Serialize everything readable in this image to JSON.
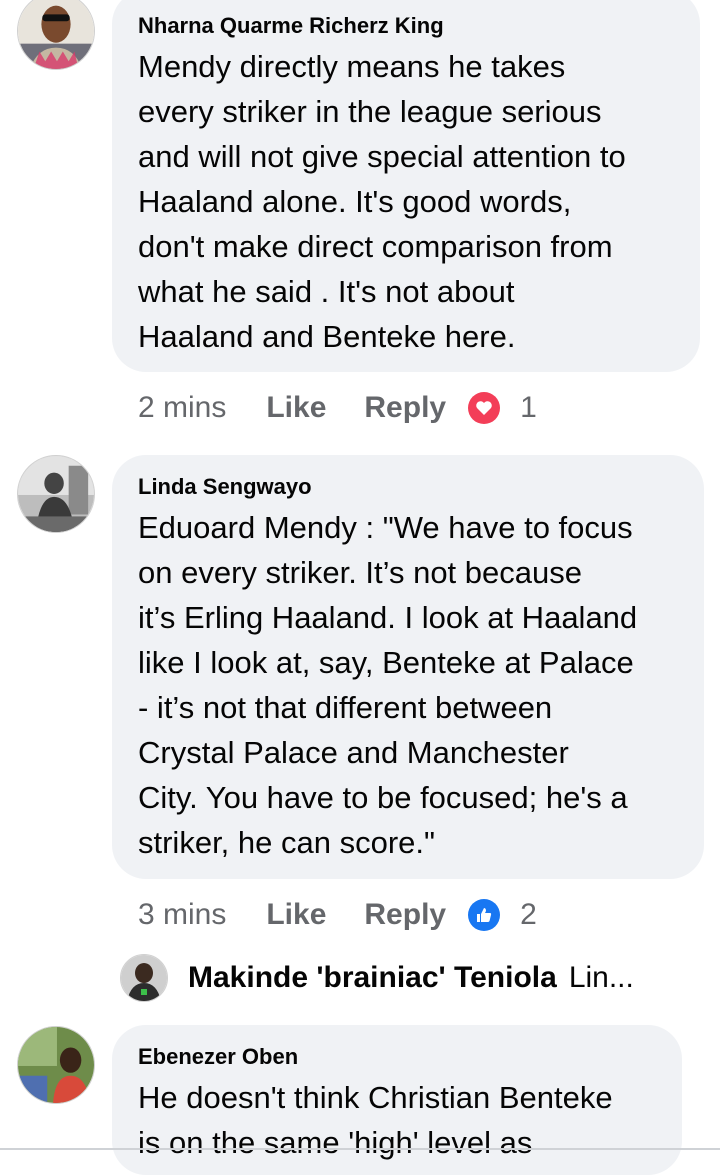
{
  "comments": [
    {
      "author": "Nharna Quarme Richerz King",
      "lines": [
        "Mendy directly means he takes",
        "every striker in the league serious",
        "and will not give special attention to",
        "Haaland alone. It's good words,",
        "don't make direct comparison from",
        "what he said . It's not about",
        "Haaland and Benteke here."
      ],
      "time": "2 mins",
      "like_label": "Like",
      "reply_label": "Reply",
      "reaction_icon": "heart-reaction-icon",
      "reaction_color": "#f33e58",
      "reaction_count": "1"
    },
    {
      "author": "Linda Sengwayo",
      "lines": [
        "Eduoard Mendy : \"We have to focus",
        "on every striker. It’s not because",
        "it’s Erling Haaland. I look at Haaland",
        "like I look at, say, Benteke at Palace",
        "- it’s not that different between",
        "Crystal Palace and Manchester",
        "City. You have to be focused; he's a",
        "striker, he can score.\""
      ],
      "time": "3 mins",
      "like_label": "Like",
      "reply_label": "Reply",
      "reaction_icon": "thumbs-up-reaction-icon",
      "reaction_color": "#1877f2",
      "reaction_count": "2"
    },
    {
      "author": "Ebenezer Oben",
      "lines": [
        "He doesn't think Christian Benteke",
        "is on the same 'high' level as"
      ]
    }
  ],
  "reply_preview": {
    "author": "Makinde 'brainiac' Teniola",
    "text": "Lin..."
  },
  "colors": {
    "bubble": "#f0f2f5",
    "secondary_text": "#65676b"
  }
}
